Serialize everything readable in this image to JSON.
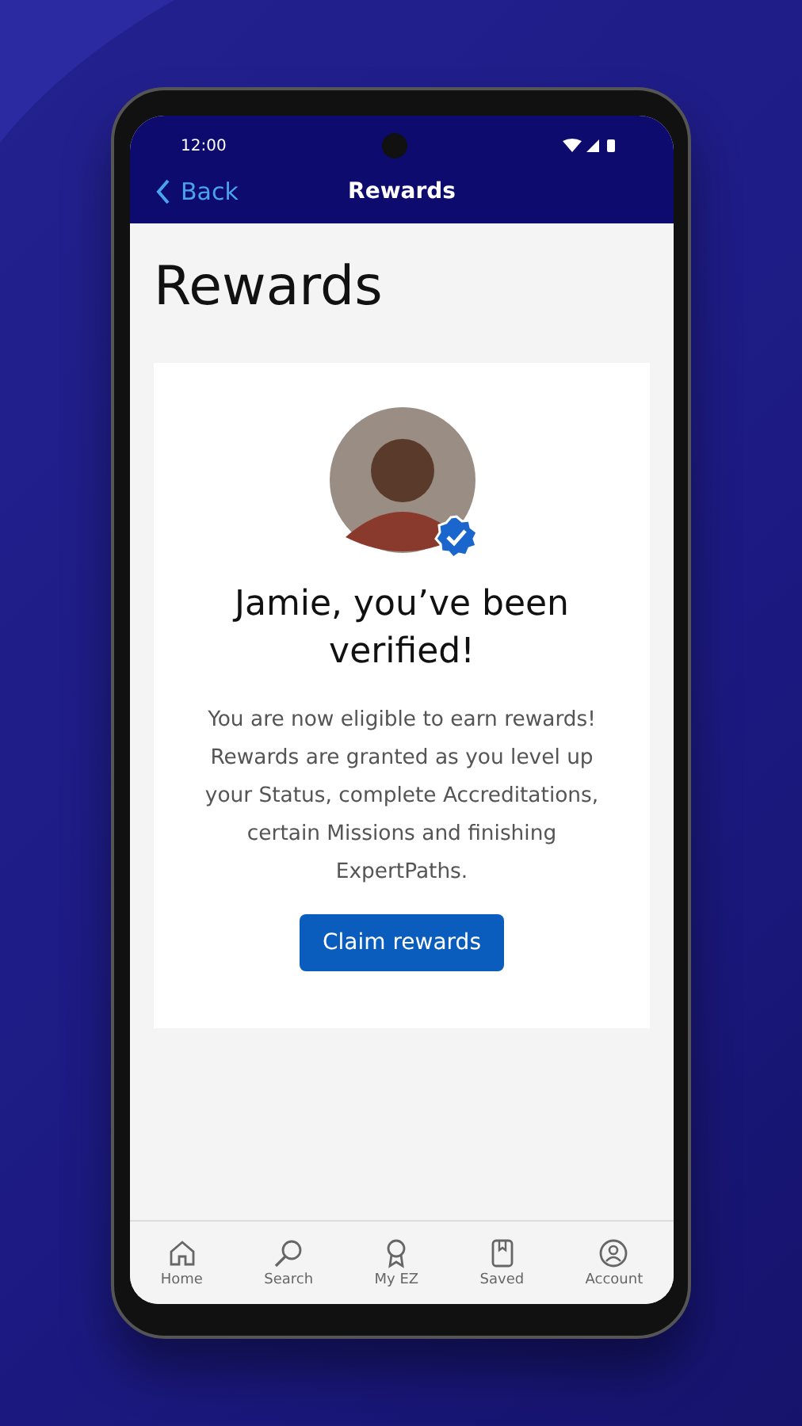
{
  "status_bar": {
    "time": "12:00"
  },
  "nav_bar": {
    "back": "Back",
    "title": "Rewards"
  },
  "page_title": "Rewards",
  "card": {
    "verified": true,
    "heading": "Jamie, you’ve been verified!",
    "body": "You are now eligible to earn rewards! Rewards are granted as you level up your Status, complete Accreditations, certain Missions and finishing ExpertPaths.",
    "button": "Claim rewards"
  },
  "tab_bar": [
    {
      "kind": "home",
      "label": "Home"
    },
    {
      "kind": "search",
      "label": "Search"
    },
    {
      "kind": "award",
      "label": "My EZ"
    },
    {
      "kind": "saved",
      "label": "Saved"
    },
    {
      "kind": "account",
      "label": "Account"
    }
  ]
}
